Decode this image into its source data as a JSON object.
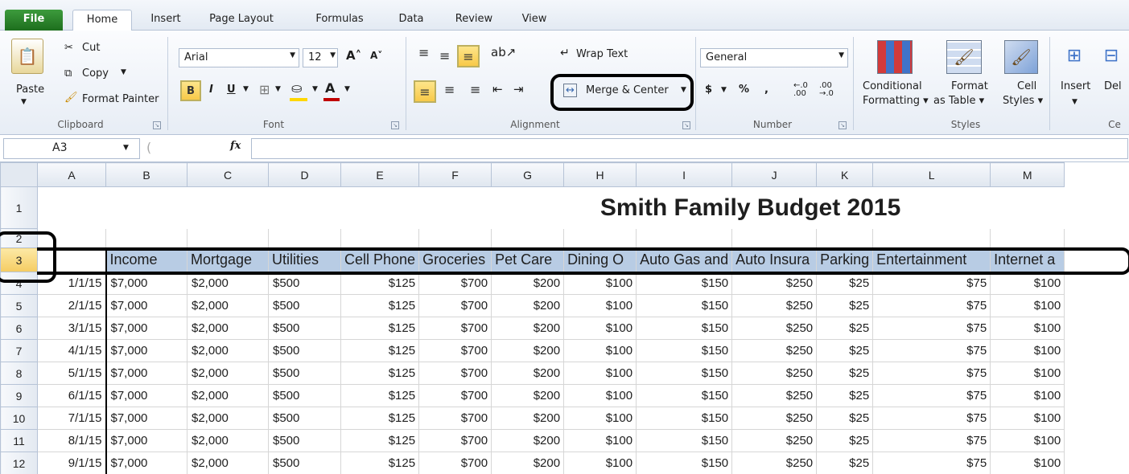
{
  "ribbon_tabs": [
    "File",
    "Home",
    "Insert",
    "Page Layout",
    "Formulas",
    "Data",
    "Review",
    "View"
  ],
  "clipboard": {
    "paste": "Paste",
    "cut": "Cut",
    "copy": "Copy",
    "format_painter": "Format Painter",
    "group": "Clipboard"
  },
  "font": {
    "name": "Arial",
    "size": "12",
    "bold": "B",
    "italic": "I",
    "underline": "U",
    "group": "Font",
    "font_color": "#c00000",
    "fill_color": "#ffd700"
  },
  "alignment": {
    "wrap_text": "Wrap Text",
    "merge_center": "Merge & Center",
    "group": "Alignment"
  },
  "number": {
    "format": "General",
    "currency": "$",
    "percent": "%",
    "comma": ",",
    "inc_decimal": "←.0 .00",
    "dec_decimal": ".00 →.0",
    "group": "Number"
  },
  "styles": {
    "conditional": "Conditional",
    "conditional2": "Formatting",
    "format_table": "Format",
    "format_table2": "as Table",
    "cell_styles": "Cell",
    "cell_styles2": "Styles",
    "group": "Styles"
  },
  "cells": {
    "insert": "Insert",
    "delete": "Del",
    "group": "Ce"
  },
  "formula_bar": {
    "name_box": "A3",
    "fx": "fx"
  },
  "columns": [
    "A",
    "B",
    "C",
    "D",
    "E",
    "F",
    "G",
    "H",
    "I",
    "J",
    "K",
    "L",
    "M"
  ],
  "title": "Smith Family Budget 2015",
  "header_row": [
    "",
    "Income",
    "Mortgage",
    "Utilities",
    "Cell Phone",
    "Groceries",
    "Pet Care",
    "Dining O",
    "Auto Gas and",
    "Auto Insura",
    "Parking",
    "Entertainment",
    "Internet a"
  ],
  "rows": [
    {
      "num": "1"
    },
    {
      "num": "2"
    },
    {
      "num": "3"
    },
    {
      "num": "4",
      "date": "1/1/15",
      "cells": [
        "$7,000",
        "$2,000",
        "$500",
        "$125",
        "$700",
        "$200",
        "$100",
        "$150",
        "$250",
        "$25",
        "$75",
        "$100"
      ]
    },
    {
      "num": "5",
      "date": "2/1/15",
      "cells": [
        "$7,000",
        "$2,000",
        "$500",
        "$125",
        "$700",
        "$200",
        "$100",
        "$150",
        "$250",
        "$25",
        "$75",
        "$100"
      ]
    },
    {
      "num": "6",
      "date": "3/1/15",
      "cells": [
        "$7,000",
        "$2,000",
        "$500",
        "$125",
        "$700",
        "$200",
        "$100",
        "$150",
        "$250",
        "$25",
        "$75",
        "$100"
      ]
    },
    {
      "num": "7",
      "date": "4/1/15",
      "cells": [
        "$7,000",
        "$2,000",
        "$500",
        "$125",
        "$700",
        "$200",
        "$100",
        "$150",
        "$250",
        "$25",
        "$75",
        "$100"
      ]
    },
    {
      "num": "8",
      "date": "5/1/15",
      "cells": [
        "$7,000",
        "$2,000",
        "$500",
        "$125",
        "$700",
        "$200",
        "$100",
        "$150",
        "$250",
        "$25",
        "$75",
        "$100"
      ]
    },
    {
      "num": "9",
      "date": "6/1/15",
      "cells": [
        "$7,000",
        "$2,000",
        "$500",
        "$125",
        "$700",
        "$200",
        "$100",
        "$150",
        "$250",
        "$25",
        "$75",
        "$100"
      ]
    },
    {
      "num": "10",
      "date": "7/1/15",
      "cells": [
        "$7,000",
        "$2,000",
        "$500",
        "$125",
        "$700",
        "$200",
        "$100",
        "$150",
        "$250",
        "$25",
        "$75",
        "$100"
      ]
    },
    {
      "num": "11",
      "date": "8/1/15",
      "cells": [
        "$7,000",
        "$2,000",
        "$500",
        "$125",
        "$700",
        "$200",
        "$100",
        "$150",
        "$250",
        "$25",
        "$75",
        "$100"
      ]
    },
    {
      "num": "12",
      "date": "9/1/15",
      "cells": [
        "$7,000",
        "$2,000",
        "$500",
        "$125",
        "$700",
        "$200",
        "$100",
        "$150",
        "$250",
        "$25",
        "$75",
        "$100"
      ]
    }
  ]
}
